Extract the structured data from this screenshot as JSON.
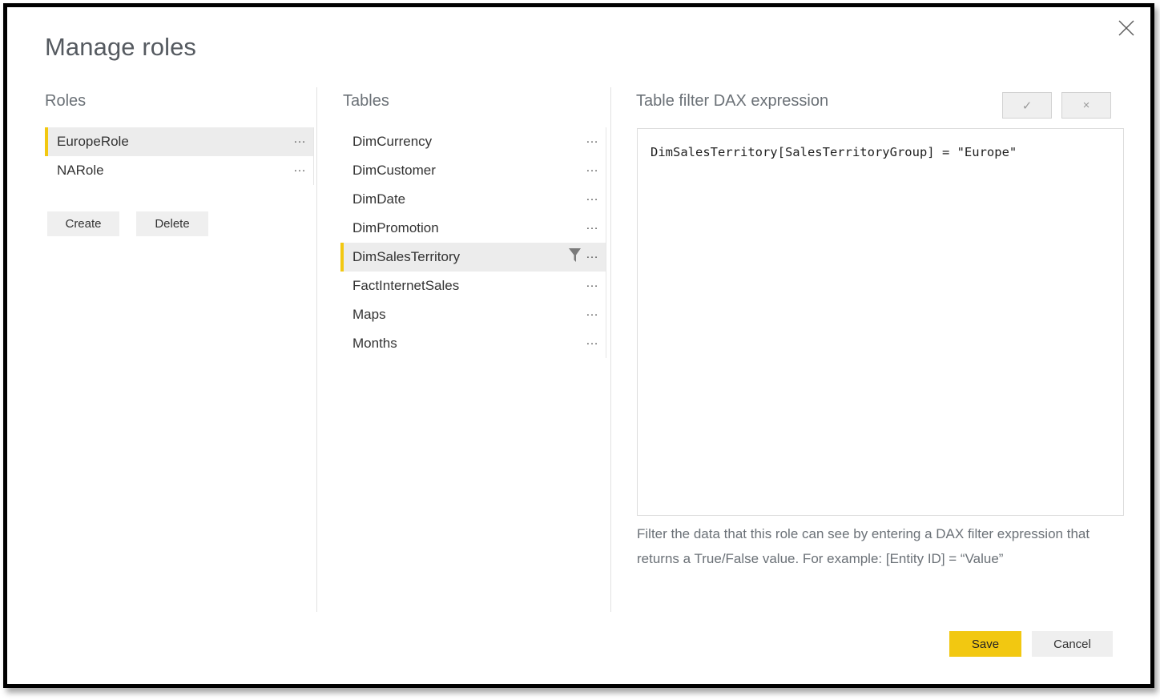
{
  "dialog": {
    "title": "Manage roles",
    "close_icon": "close-icon"
  },
  "roles_panel": {
    "heading": "Roles",
    "items": [
      {
        "label": "EuropeRole",
        "selected": true,
        "menu_icon": "ellipsis-icon"
      },
      {
        "label": "NARole",
        "selected": false,
        "menu_icon": "ellipsis-icon"
      }
    ],
    "create_label": "Create",
    "delete_label": "Delete"
  },
  "tables_panel": {
    "heading": "Tables",
    "items": [
      {
        "label": "DimCurrency",
        "selected": false,
        "filtered": false,
        "menu_icon": "ellipsis-icon"
      },
      {
        "label": "DimCustomer",
        "selected": false,
        "filtered": false,
        "menu_icon": "ellipsis-icon"
      },
      {
        "label": "DimDate",
        "selected": false,
        "filtered": false,
        "menu_icon": "ellipsis-icon"
      },
      {
        "label": "DimPromotion",
        "selected": false,
        "filtered": false,
        "menu_icon": "ellipsis-icon"
      },
      {
        "label": "DimSalesTerritory",
        "selected": true,
        "filtered": true,
        "filter_icon": "funnel-icon",
        "menu_icon": "ellipsis-icon"
      },
      {
        "label": "FactInternetSales",
        "selected": false,
        "filtered": false,
        "menu_icon": "ellipsis-icon"
      },
      {
        "label": "Maps",
        "selected": false,
        "filtered": false,
        "menu_icon": "ellipsis-icon"
      },
      {
        "label": "Months",
        "selected": false,
        "filtered": false,
        "menu_icon": "ellipsis-icon"
      }
    ]
  },
  "dax_panel": {
    "heading": "Table filter DAX expression",
    "accept_label": "✓",
    "discard_label": "×",
    "expression": "DimSalesTerritory[SalesTerritoryGroup] = \"Europe\"",
    "help_text": "Filter the data that this role can see by entering a DAX filter expression that returns a True/False value. For example: [Entity ID] = “Value”"
  },
  "footer": {
    "save_label": "Save",
    "cancel_label": "Cancel"
  },
  "colors": {
    "accent_yellow": "#f2c811",
    "selected_row_bg": "#ececec",
    "button_gray": "#efefef",
    "heading_gray": "#6b7177",
    "frame_black": "#000000"
  }
}
